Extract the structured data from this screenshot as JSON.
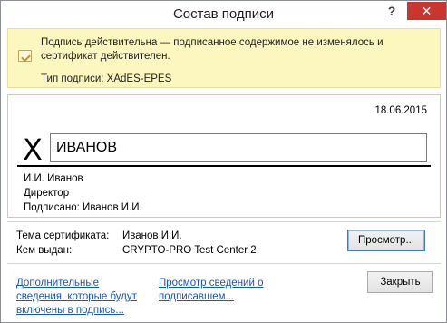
{
  "window": {
    "title": "Состав подписи",
    "help_glyph": "?",
    "close_glyph": "✕"
  },
  "info": {
    "message": "Подпись действительна — подписанное содержимое не изменялось и сертификат действителен.",
    "signature_type": "Тип подписи: XAdES-EPES",
    "icon": "signature-valid-icon"
  },
  "signature": {
    "date": "18.06.2015",
    "x_mark": "X",
    "signed_name": "ИВАНОВ",
    "signer_name": "И.И. Иванов",
    "signer_title": "Директор",
    "signed_by": "Подписано: Иванов И.И."
  },
  "certificate": {
    "subject_label": "Тема сертификата:",
    "subject_value": "Иванов И.И.",
    "issuer_label": "Кем выдан:",
    "issuer_value": "CRYPTO-PRO Test Center 2",
    "view_button": "Просмотр..."
  },
  "footer": {
    "link_additional": "Дополнительные сведения, которые будут включены в подпись...",
    "link_signer": "Просмотр сведений о подписавшем...",
    "close_button": "Закрыть"
  }
}
